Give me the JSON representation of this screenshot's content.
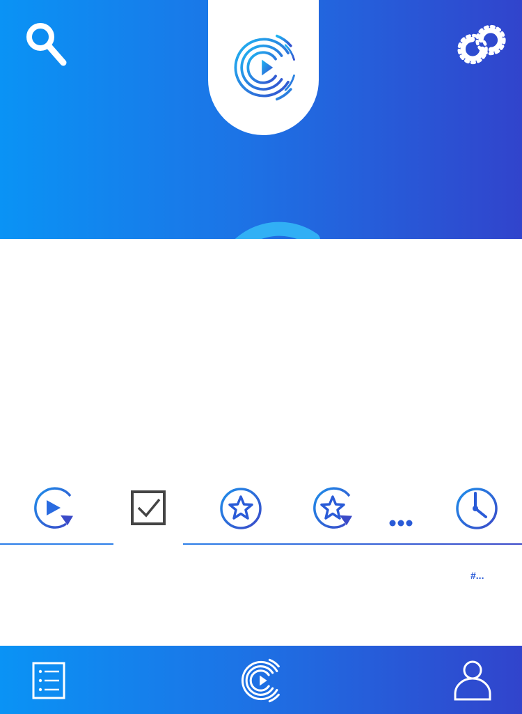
{
  "header": {
    "search_icon": "search-icon",
    "link_icon": "link-gear-icon",
    "logo_icon": "app-logo-icon"
  },
  "tabs": {
    "items": [
      {
        "icon": "play-refresh-icon",
        "selected": false
      },
      {
        "icon": "checkbox-icon",
        "selected": true
      },
      {
        "icon": "star-circle-icon",
        "selected": false
      },
      {
        "icon": "star-refresh-icon",
        "selected": false
      },
      {
        "icon": "more-dots-icon",
        "selected": false
      },
      {
        "icon": "clock-icon",
        "selected": false
      }
    ],
    "hashtag_label": "#..."
  },
  "bottom_nav": {
    "items": [
      {
        "icon": "list-icon"
      },
      {
        "icon": "app-logo-icon"
      },
      {
        "icon": "profile-icon"
      }
    ]
  },
  "colors": {
    "gradient_start": "#0a93f5",
    "gradient_end": "#3144cc",
    "accent": "#2a5bd7",
    "checkbox": "#444444"
  }
}
